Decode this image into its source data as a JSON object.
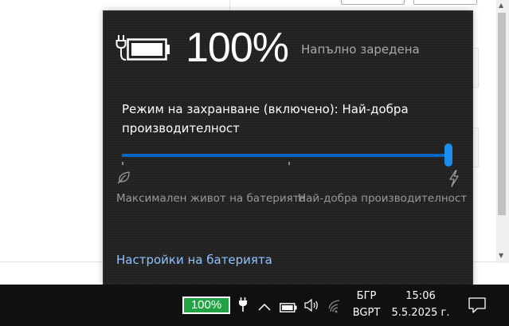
{
  "flyout": {
    "percent": "100%",
    "status": "Напълно заредена",
    "power_mode": "Режим на захранване (включено): Най-добра производителност",
    "slider": {
      "value_fraction": 1.0,
      "left_label": "Максимален живот на батерията",
      "right_label": "Най-добра производителност"
    },
    "settings_link": "Настройки на батерията",
    "icons": {
      "plug": "power-plug-icon",
      "battery": "battery-full-icon",
      "leaf": "battery-saver-leaf-icon",
      "bolt": "lightning-bolt-icon"
    }
  },
  "taskbar": {
    "battery_percent": "100%",
    "language": "БГР",
    "keyboard": "BGPT",
    "time": "15:06",
    "date": "5.5.2025 г.",
    "icons": [
      "power-plug-icon",
      "chevron-up-icon",
      "battery-icon",
      "speaker-icon",
      "wifi-icon",
      "notification-icon"
    ]
  },
  "colors": {
    "flyout_bg": "#202020",
    "accent": "#0067c0",
    "link": "#8fc3ff",
    "taskbar_bg": "#101010",
    "battery_badge": "#22a242"
  }
}
